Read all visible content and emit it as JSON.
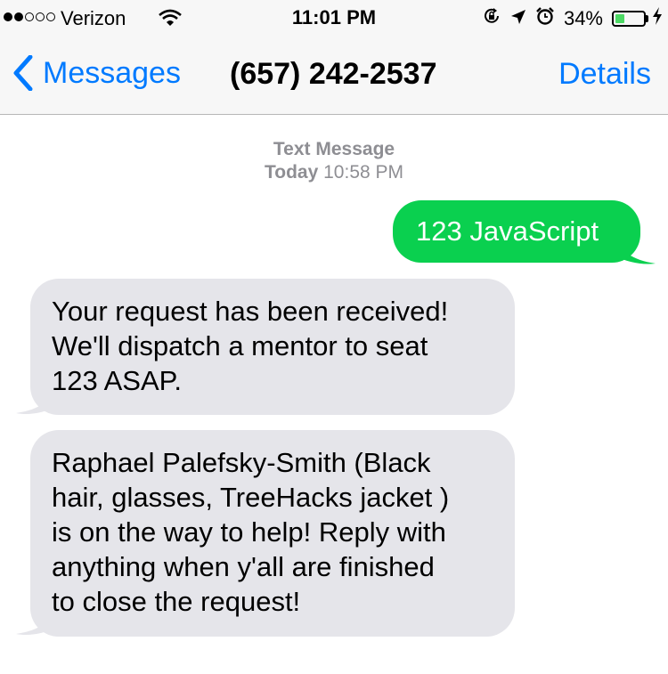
{
  "status_bar": {
    "carrier": "Verizon",
    "signal_bars": 2,
    "signal_total": 5,
    "time": "11:01 PM",
    "battery_percent": "34%",
    "battery_level": 0.34,
    "battery_color": "#4cd964",
    "icons": [
      "wifi-icon",
      "rotation-lock-icon",
      "location-icon",
      "alarm-icon",
      "charging-bolt-icon"
    ]
  },
  "nav": {
    "back_label": "Messages",
    "title": "(657) 242-2537",
    "details_label": "Details",
    "accent_color": "#007aff"
  },
  "thread": {
    "service_label": "Text Message",
    "day_label": "Today",
    "time_label": "10:58 PM",
    "messages": [
      {
        "direction": "outgoing",
        "color": "#0ad04f",
        "lines": [
          "123 JavaScript"
        ]
      },
      {
        "direction": "incoming",
        "color": "#e5e5ea",
        "lines": [
          "Your request has been received!",
          "We'll dispatch a mentor to seat",
          "123 ASAP."
        ]
      },
      {
        "direction": "incoming",
        "color": "#e5e5ea",
        "lines": [
          "Raphael Palefsky-Smith (Black",
          "hair, glasses, TreeHacks jacket )",
          "is on the way to help! Reply with",
          "anything when y'all are finished",
          "to close the request!"
        ]
      }
    ]
  }
}
